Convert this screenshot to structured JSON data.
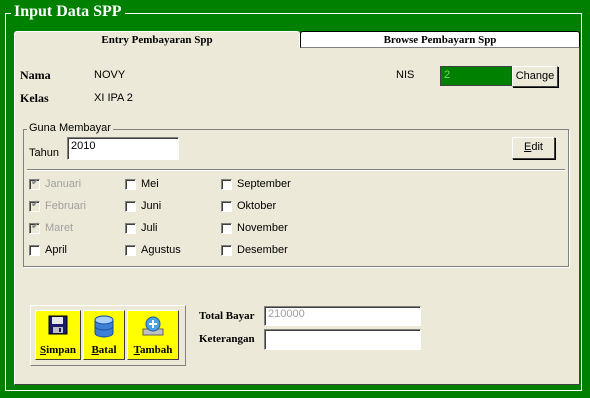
{
  "window": {
    "title": "Input Data SPP"
  },
  "tabs": [
    {
      "label": "Entry Pembayaran Spp",
      "active": true
    },
    {
      "label": "Browse Pembayarn Spp",
      "active": false
    }
  ],
  "student": {
    "nama_label": "Nama",
    "nama_value": "NOVY",
    "kelas_label": "Kelas",
    "kelas_value": "XI IPA 2",
    "nis_label": "NIS",
    "nis_value": "2",
    "change_label": "Change"
  },
  "guna": {
    "legend": "Guna Membayar",
    "tahun_label": "Tahun",
    "tahun_value": "2010",
    "edit_label": "Edit",
    "months": [
      {
        "label": "Januari",
        "checked": true,
        "enabled": false
      },
      {
        "label": "Februari",
        "checked": true,
        "enabled": false
      },
      {
        "label": "Maret",
        "checked": true,
        "enabled": false
      },
      {
        "label": "April",
        "checked": false,
        "enabled": true
      },
      {
        "label": "Mei",
        "checked": false,
        "enabled": true
      },
      {
        "label": "Juni",
        "checked": false,
        "enabled": true
      },
      {
        "label": "Juli",
        "checked": false,
        "enabled": true
      },
      {
        "label": "Agustus",
        "checked": false,
        "enabled": true
      },
      {
        "label": "September",
        "checked": false,
        "enabled": true
      },
      {
        "label": "Oktober",
        "checked": false,
        "enabled": true
      },
      {
        "label": "November",
        "checked": false,
        "enabled": true
      },
      {
        "label": "Desember",
        "checked": false,
        "enabled": true
      }
    ]
  },
  "actions": {
    "simpan": "Simpan",
    "batal": "Batal",
    "tambah": "Tambah"
  },
  "payment": {
    "total_label": "Total Bayar",
    "total_value": "210000",
    "keterangan_label": "Keterangan",
    "keterangan_value": ""
  },
  "colors": {
    "frame": "#008000",
    "panel": "#ece9d8",
    "button": "#ffff00"
  }
}
